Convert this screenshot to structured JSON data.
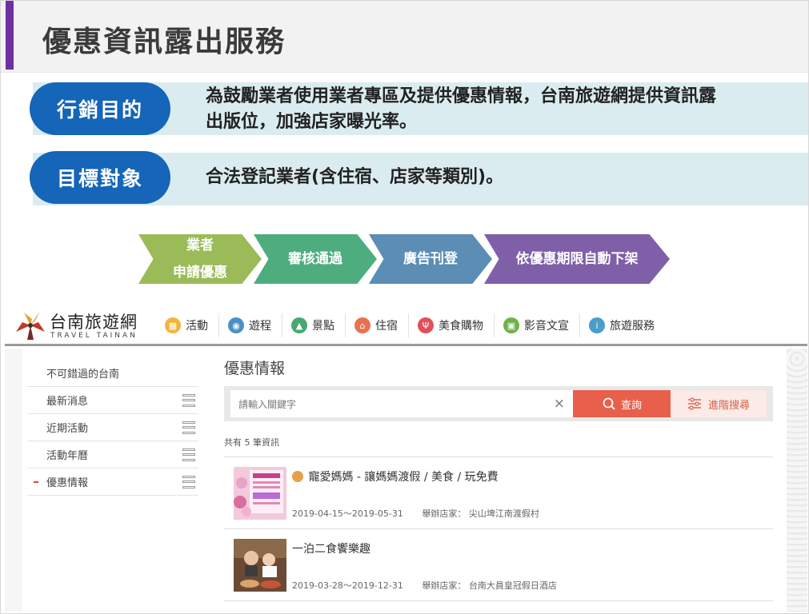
{
  "slide": {
    "title": "優惠資訊露出服務",
    "marketing_label": "行銷目的",
    "marketing_text_line1": "為鼓勵業者使用業者專區及提供優惠情報，台南旅遊網提供資訊露",
    "marketing_text_line2": "出版位，加強店家曝光率。",
    "target_label": "目標對象",
    "target_text": "合法登記業者(含住宿、店家等類別)。",
    "flow": [
      {
        "line1": "業者",
        "line2": "申請優惠"
      },
      {
        "line1": "審核通過"
      },
      {
        "line1": "廣告刊登"
      },
      {
        "line1": "依優惠期限自動下架"
      }
    ],
    "colors": {
      "accent": "#7030a0",
      "pill": "#1565b8",
      "band": "#dbecf0"
    }
  },
  "site": {
    "logo_cn": "台南旅遊網",
    "logo_en": "TRAVEL TAINAN",
    "nav": [
      {
        "label": "活動",
        "icon": "calendar-icon",
        "color": "#f2b43c"
      },
      {
        "label": "遊程",
        "icon": "map-pin-icon",
        "color": "#4a90c8"
      },
      {
        "label": "景點",
        "icon": "landscape-icon",
        "color": "#47a870"
      },
      {
        "label": "住宿",
        "icon": "house-icon",
        "color": "#e8714f"
      },
      {
        "label": "美食購物",
        "icon": "fork-knife-icon",
        "color": "#e0505a"
      },
      {
        "label": "影音文宣",
        "icon": "video-icon",
        "color": "#6fb14a"
      },
      {
        "label": "旅遊服務",
        "icon": "info-icon",
        "color": "#4a9ec9"
      }
    ],
    "sidebar": [
      {
        "label": "不可錯過的台南"
      },
      {
        "label": "最新消息"
      },
      {
        "label": "近期活動"
      },
      {
        "label": "活動年曆"
      },
      {
        "label": "優惠情報"
      }
    ],
    "main": {
      "page_title": "優惠情報",
      "search_placeholder": "請輸入關鍵字",
      "clear_symbol": "×",
      "search_button": "查詢",
      "advanced_button": "進階搜尋",
      "count_text": "共有 5 筆資訊",
      "items": [
        {
          "title": "寵愛媽媽 - 讓媽媽渡假 / 美食 / 玩免費",
          "date": "2019-04-15～2019-05-31",
          "organizer": "舉辦店家： 尖山埤江南渡假村"
        },
        {
          "title": "一泊二食饗樂趣",
          "date": "2019-03-28～2019-12-31",
          "organizer": "舉辦店家： 台南大員皇冠假日酒店"
        }
      ]
    }
  }
}
